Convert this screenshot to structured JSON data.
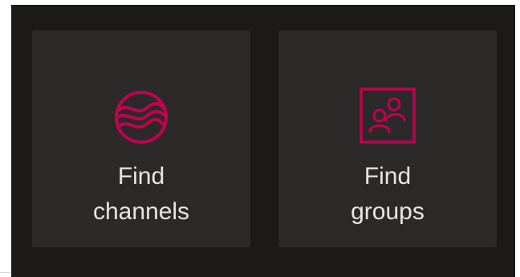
{
  "colors": {
    "accent": "#c30052",
    "panel_bg": "#1b1a19",
    "tile_bg": "#2b2a29",
    "text": "#e8e6e3"
  },
  "tiles": [
    {
      "icon": "channels-globe-icon",
      "line1": "Find",
      "line2": "channels"
    },
    {
      "icon": "groups-people-icon",
      "line1": "Find",
      "line2": "groups"
    }
  ]
}
